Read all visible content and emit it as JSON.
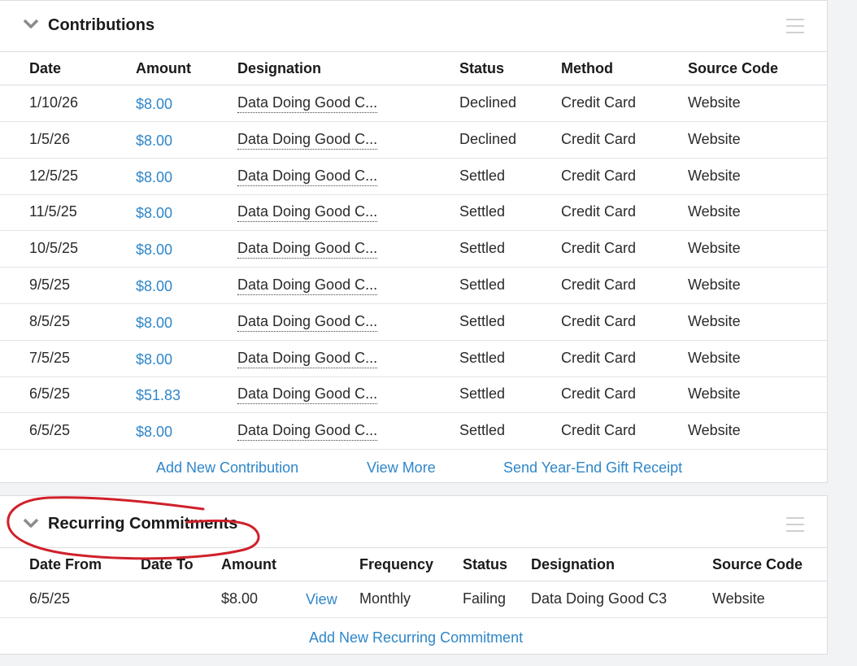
{
  "contributions": {
    "title": "Contributions",
    "columns": [
      "Date",
      "Amount",
      "Designation",
      "Status",
      "Method",
      "Source Code"
    ],
    "rows": [
      {
        "date": "1/10/26",
        "amount": "$8.00",
        "designation": "Data Doing Good C...",
        "status": "Declined",
        "method": "Credit Card",
        "source": "Website"
      },
      {
        "date": "1/5/26",
        "amount": "$8.00",
        "designation": "Data Doing Good C...",
        "status": "Declined",
        "method": "Credit Card",
        "source": "Website"
      },
      {
        "date": "12/5/25",
        "amount": "$8.00",
        "designation": "Data Doing Good C...",
        "status": "Settled",
        "method": "Credit Card",
        "source": "Website"
      },
      {
        "date": "11/5/25",
        "amount": "$8.00",
        "designation": "Data Doing Good C...",
        "status": "Settled",
        "method": "Credit Card",
        "source": "Website"
      },
      {
        "date": "10/5/25",
        "amount": "$8.00",
        "designation": "Data Doing Good C...",
        "status": "Settled",
        "method": "Credit Card",
        "source": "Website"
      },
      {
        "date": "9/5/25",
        "amount": "$8.00",
        "designation": "Data Doing Good C...",
        "status": "Settled",
        "method": "Credit Card",
        "source": "Website"
      },
      {
        "date": "8/5/25",
        "amount": "$8.00",
        "designation": "Data Doing Good C...",
        "status": "Settled",
        "method": "Credit Card",
        "source": "Website"
      },
      {
        "date": "7/5/25",
        "amount": "$8.00",
        "designation": "Data Doing Good C...",
        "status": "Settled",
        "method": "Credit Card",
        "source": "Website"
      },
      {
        "date": "6/5/25",
        "amount": "$51.83",
        "designation": "Data Doing Good C...",
        "status": "Settled",
        "method": "Credit Card",
        "source": "Website"
      },
      {
        "date": "6/5/25",
        "amount": "$8.00",
        "designation": "Data Doing Good C...",
        "status": "Settled",
        "method": "Credit Card",
        "source": "Website"
      }
    ],
    "footer_links": {
      "add": "Add New Contribution",
      "view_more": "View More",
      "receipt": "Send Year-End Gift Receipt"
    }
  },
  "recurring": {
    "title": "Recurring Commitments",
    "columns": {
      "date_from": "Date From",
      "date_to": "Date To",
      "amount": "Amount",
      "frequency": "Frequency",
      "status": "Status",
      "designation": "Designation",
      "source": "Source Code"
    },
    "rows": [
      {
        "date_from": "6/5/25",
        "date_to": "",
        "amount": "$8.00",
        "view": "View",
        "frequency": "Monthly",
        "status": "Failing",
        "designation": "Data Doing Good C3",
        "source": "Website"
      }
    ],
    "footer_link": "Add New Recurring Commitment"
  },
  "icons": {
    "collapse": "chevron-down-icon",
    "menu": "hamburger-menu-icon"
  },
  "colors": {
    "link": "#2f86c9",
    "annotation": "#d0202a"
  }
}
